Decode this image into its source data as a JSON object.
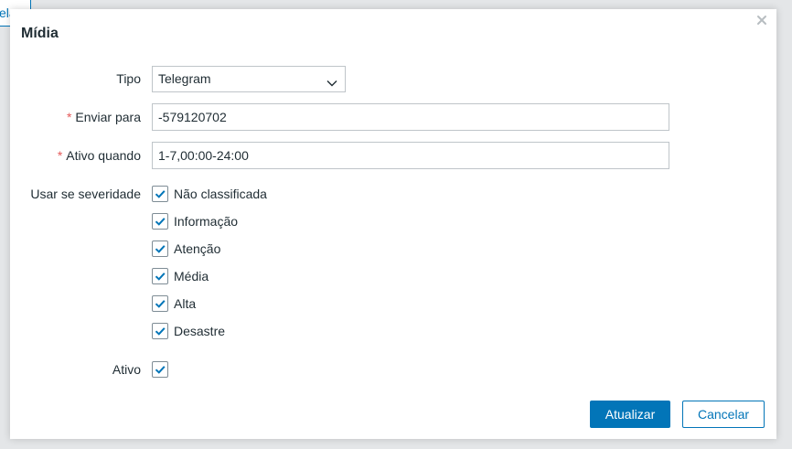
{
  "background": {
    "button_fragment": "ela"
  },
  "dialog": {
    "title": "Mídia",
    "close_icon": "close-icon"
  },
  "form": {
    "type": {
      "label": "Tipo",
      "value": "Telegram"
    },
    "send_to": {
      "required_mark": "*",
      "label": "Enviar para",
      "value": "-579120702"
    },
    "active_when": {
      "required_mark": "*",
      "label": "Ativo quando",
      "value": "1-7,00:00-24:00"
    },
    "severity": {
      "label": "Usar se severidade",
      "options": [
        {
          "label": "Não classificada",
          "checked": true
        },
        {
          "label": "Informação",
          "checked": true
        },
        {
          "label": "Atenção",
          "checked": true
        },
        {
          "label": "Média",
          "checked": true
        },
        {
          "label": "Alta",
          "checked": true
        },
        {
          "label": "Desastre",
          "checked": true
        }
      ]
    },
    "enabled": {
      "label": "Ativo",
      "checked": true
    }
  },
  "buttons": {
    "update": "Atualizar",
    "cancel": "Cancelar"
  },
  "colors": {
    "accent": "#0275b8",
    "required": "#e45959",
    "text": "#1f2c33",
    "border": "#bfc5c9"
  }
}
